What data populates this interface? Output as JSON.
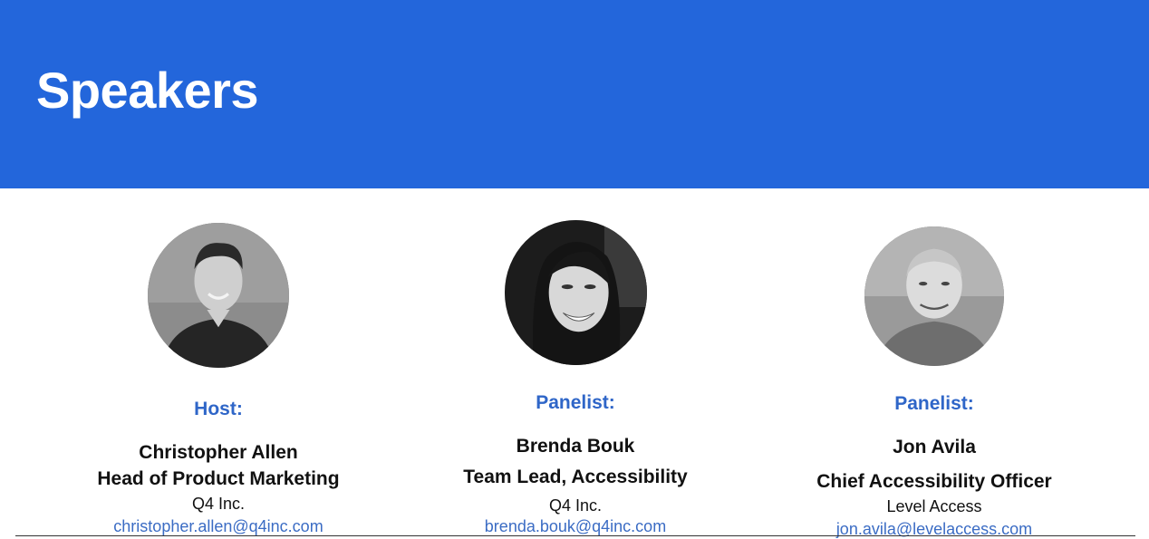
{
  "header": {
    "title": "Speakers",
    "background_color": "#2366db"
  },
  "speakers": [
    {
      "role": "Host:",
      "name": "Christopher Allen",
      "title": "Head of Product Marketing",
      "company": "Q4 Inc.",
      "email": "christopher.allen@q4inc.com",
      "photo_icon": "person-photo"
    },
    {
      "role": "Panelist:",
      "name": "Brenda Bouk",
      "title": "Team Lead, Accessibility",
      "company": "Q4 Inc.",
      "email": "brenda.bouk@q4inc.com",
      "photo_icon": "person-photo"
    },
    {
      "role": "Panelist:",
      "name": "Jon Avila",
      "title": "Chief Accessibility Officer",
      "company": "Level Access",
      "email": "jon.avila@levelaccess.com",
      "photo_icon": "person-photo"
    }
  ],
  "colors": {
    "role_label": "#2f66c8",
    "email_link": "#3b6cc4"
  }
}
